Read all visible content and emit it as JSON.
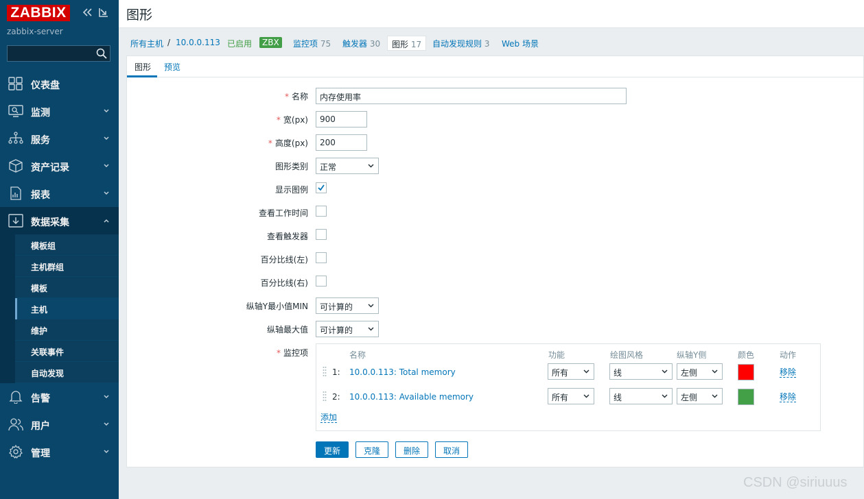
{
  "sidebar": {
    "logo": "ZABBIX",
    "server_name": "zabbix-server",
    "search_placeholder": "",
    "menu": [
      {
        "label": "仪表盘"
      },
      {
        "label": "监测"
      },
      {
        "label": "服务"
      },
      {
        "label": "资产记录"
      },
      {
        "label": "报表"
      },
      {
        "label": "数据采集"
      },
      {
        "label": "告警"
      },
      {
        "label": "用户"
      },
      {
        "label": "管理"
      }
    ],
    "submenu": [
      "模板组",
      "主机群组",
      "模板",
      "主机",
      "维护",
      "关联事件",
      "自动发现"
    ]
  },
  "header": {
    "title": "图形"
  },
  "breadcrumbs": {
    "all_hosts": "所有主机",
    "separator": "/",
    "host": "10.0.0.113",
    "status": "已启用",
    "zbx_badge": "ZBX",
    "items_label": "监控项",
    "items_count": "75",
    "triggers_label": "触发器",
    "triggers_count": "30",
    "graphs_label": "图形",
    "graphs_count": "17",
    "discovery_label": "自动发现规则",
    "discovery_count": "3",
    "web_label": "Web 场景"
  },
  "tabs": [
    "图形",
    "预览"
  ],
  "form": {
    "name_label": "名称",
    "name_value": "内存使用率",
    "width_label": "宽(px)",
    "width_value": "900",
    "height_label": "高度(px)",
    "height_value": "200",
    "type_label": "图形类别",
    "type_value": "正常",
    "legend_label": "显示图例",
    "worktime_label": "查看工作时间",
    "triggers_label": "查看触发器",
    "pct_left_label": "百分比线(左)",
    "pct_right_label": "百分比线(右)",
    "ymin_label": "纵轴Y最小值MIN",
    "ymin_value": "可计算的",
    "ymax_label": "纵轴最大值",
    "ymax_value": "可计算的",
    "items_label": "监控项"
  },
  "items_table": {
    "headers": [
      "名称",
      "功能",
      "绘图风格",
      "纵轴Y侧",
      "颜色",
      "动作"
    ],
    "rows": [
      {
        "idx": "1:",
        "name": "10.0.0.113: Total memory",
        "func": "所有",
        "style": "线",
        "side": "左侧",
        "color": "#ff0000",
        "action": "移除"
      },
      {
        "idx": "2:",
        "name": "10.0.0.113: Available memory",
        "func": "所有",
        "style": "线",
        "side": "左侧",
        "color": "#43a047",
        "action": "移除"
      }
    ],
    "add_label": "添加"
  },
  "buttons": {
    "update": "更新",
    "clone": "克隆",
    "delete": "删除",
    "cancel": "取消"
  },
  "watermark": "CSDN @siriuuus"
}
